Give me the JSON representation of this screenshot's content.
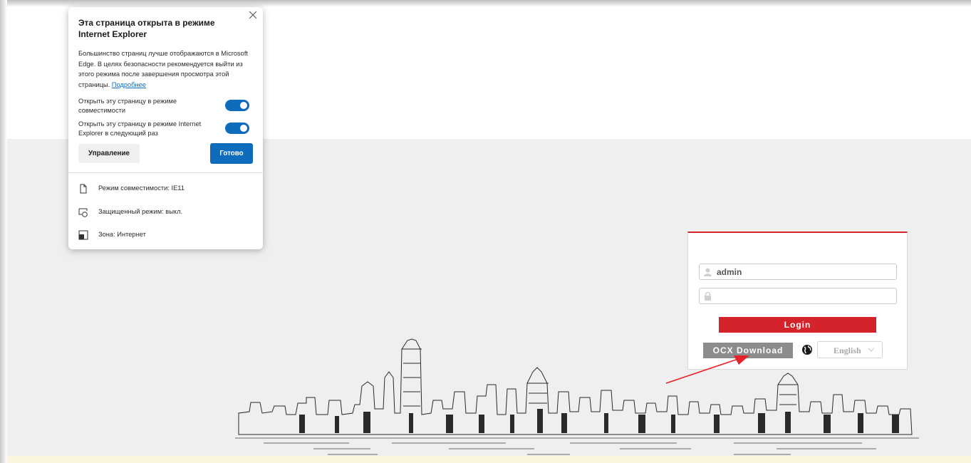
{
  "ie_flyout": {
    "title": "Эта страница открыта в режиме Internet Explorer",
    "description": "Большинство страниц лучше отображаются в Microsoft Edge. В целях безопасности рекомендуется выйти из этого режима после завершения просмотра этой страницы.",
    "learn_more_link": "Подробнее",
    "toggle_compat_label": "Открыть эту страницу в режиме совместимости",
    "toggle_compat_on": true,
    "toggle_next_time_label": "Открыть эту страницу в режиме Internet Explorer в следующий раз",
    "toggle_next_time_on": true,
    "manage_button": "Управление",
    "done_button": "Готово",
    "info": {
      "compat_mode": "Режим совместимости: IE11",
      "protected_mode": "Защищенный режим: выкл.",
      "zone": "Зона: Интернет"
    },
    "icons": [
      "close-icon",
      "document-icon",
      "protected-mode-icon",
      "zone-icon"
    ]
  },
  "login": {
    "username_value": "admin",
    "password_value": "",
    "login_button": "Login",
    "ocx_button": "OCX Download",
    "language_selected": "English",
    "icons": [
      "user-icon",
      "lock-icon",
      "globe-icon",
      "chevron-down-icon"
    ]
  },
  "colors": {
    "accent_red": "#d4232a",
    "edge_blue": "#0f6cbd",
    "ocx_gray": "#8c8c8c",
    "page_background": "#efefef",
    "annotation_arrow": "#e8222a"
  }
}
